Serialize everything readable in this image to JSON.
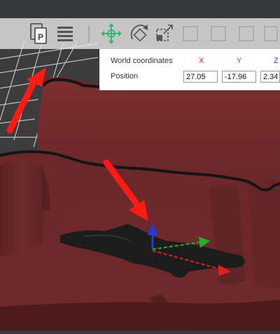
{
  "coordinates_panel": {
    "title": "World coordinates",
    "axes": {
      "x": "X",
      "y": "Y",
      "z": "Z"
    },
    "position_label": "Position",
    "position": {
      "x": "27.05",
      "y": "-17.96",
      "z": "2.34"
    }
  },
  "toolbar": {
    "icons": [
      "copy-part-icon",
      "arrange-icon",
      "layers-icon",
      "move-icon",
      "rotate-icon",
      "scale-icon"
    ]
  },
  "colors": {
    "model": "#6e2a2c",
    "model_shadow": "#4f1b1d",
    "annotation_arrow": "#ff1a14",
    "axis_x": "#e02020",
    "axis_y": "#22b322",
    "axis_z": "#1f3fdc",
    "move_icon": "#2bb673"
  }
}
